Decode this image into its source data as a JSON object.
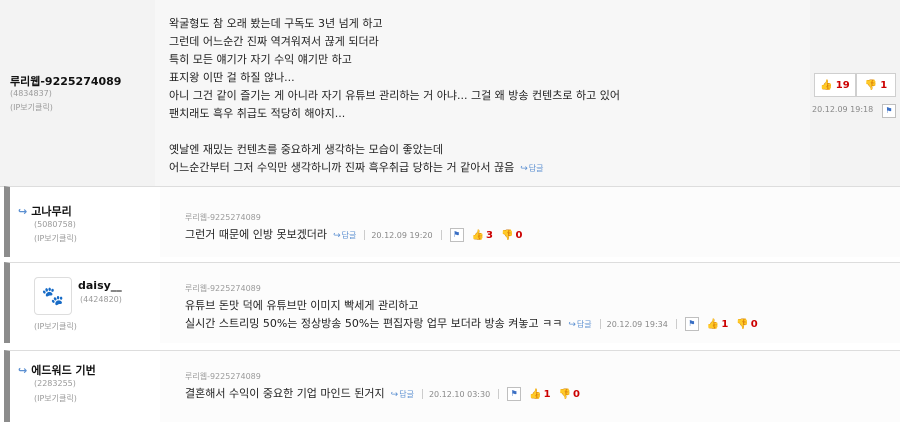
{
  "main_comment": {
    "nickname": "루리웹-9225274089",
    "user_id": "(4834837)",
    "ip_view": "(IP보기클릭)",
    "lines": [
      "왁굴형도 참 오래 봤는데 구독도 3년 넘게 하고",
      "그런데 어느순간 진짜 역겨워져서 끊게 되더라",
      "특히 모든 얘기가 자기 수익 얘기만 하고",
      "표지왕 이딴 걸 하질 않나...",
      "아니 그건 같이 즐기는 게 아니라 자기 유튜브 관리하는 거 아냐... 그걸 왜 방송 컨텐츠로 하고 있어",
      "팬치래도 흑우 취급도 적당히 해야지...",
      "",
      "옛날엔 재밌는 컨텐츠를 중요하게 생각하는 모습이 좋았는데",
      "어느순간부터 그저 수익만 생각하니까 진짜 흑우취급 당하는 거 같아서 끊음"
    ],
    "reply_label": "답글",
    "up_count": "19",
    "down_count": "1",
    "date": "20.12.09 19:18"
  },
  "replies": [
    {
      "nickname": "고나무리",
      "user_id": "(5080758)",
      "ip_view": "(IP보기클릭)",
      "original_author": "루리웹-9225274089",
      "lines": [
        "그런거 때문에 인방 못보겠더라"
      ],
      "reply_label": "답글",
      "date": "20.12.09 19:20",
      "up_count": "3",
      "down_count": "0"
    },
    {
      "nickname": "daisy__",
      "user_id": "(4424820)",
      "ip_view": "(IP보기클릭)",
      "original_author": "루리웹-9225274089",
      "lines": [
        "유튜브 돈맛 덕에 유튜브만 이미지 빡세게 관리하고",
        "실시간 스트리밍 50%는 정상방송 50%는 편집자랑 업무 보더라 방송 켜놓고 ㅋㅋ"
      ],
      "reply_label": "답글",
      "date": "20.12.09 19:34",
      "up_count": "1",
      "down_count": "0"
    },
    {
      "nickname": "에드워드 기번",
      "user_id": "(2283255)",
      "ip_view": "(IP보기클릭)",
      "original_author": "루리웹-9225274089",
      "lines": [
        "결혼해서 수익이 중요한 기업 마인드 된거지"
      ],
      "reply_label": "답글",
      "date": "20.12.10 03:30",
      "up_count": "1",
      "down_count": "0"
    }
  ],
  "icons": {
    "thumb_up": "thumbs-up-icon",
    "thumb_down": "thumbs-down-icon",
    "report": "report-icon",
    "reply_arrow": "reply-arrow-icon"
  },
  "colors": {
    "vote_count": "#cc0000",
    "link_blue": "#5b8fd1",
    "main_bg": "#f3f3f3"
  }
}
